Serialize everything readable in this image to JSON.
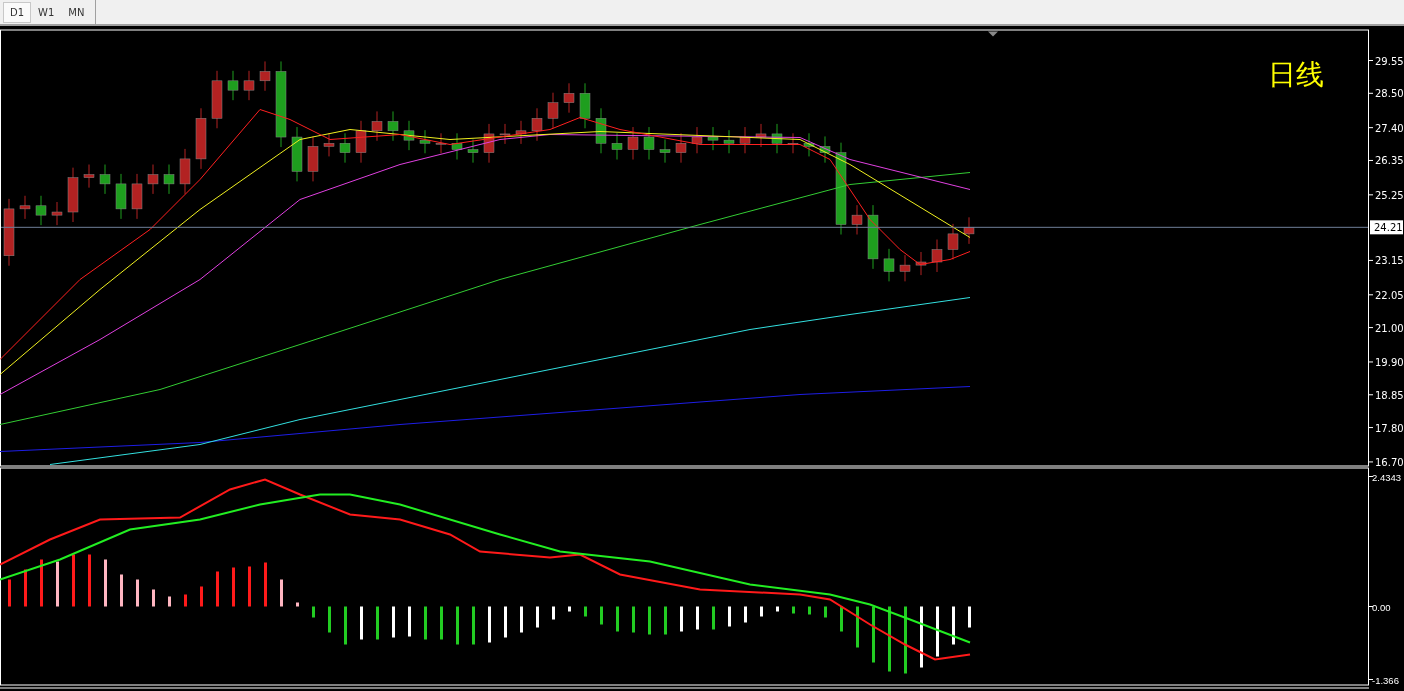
{
  "timeframe_tabs": [
    {
      "label": "D1",
      "selected": true
    },
    {
      "label": "W1",
      "selected": false
    },
    {
      "label": "MN",
      "selected": false
    }
  ],
  "price_chart": {
    "title": "日线",
    "axis_labels": [
      "29.55",
      "28.50",
      "27.40",
      "26.35",
      "25.25",
      "23.15",
      "22.05",
      "21.00",
      "19.90",
      "18.85",
      "17.80",
      "16.70"
    ],
    "current_price": "24.21"
  },
  "indicator_chart": {
    "axis_labels": [
      "2.4343",
      "0.00",
      "-1.366"
    ]
  }
}
